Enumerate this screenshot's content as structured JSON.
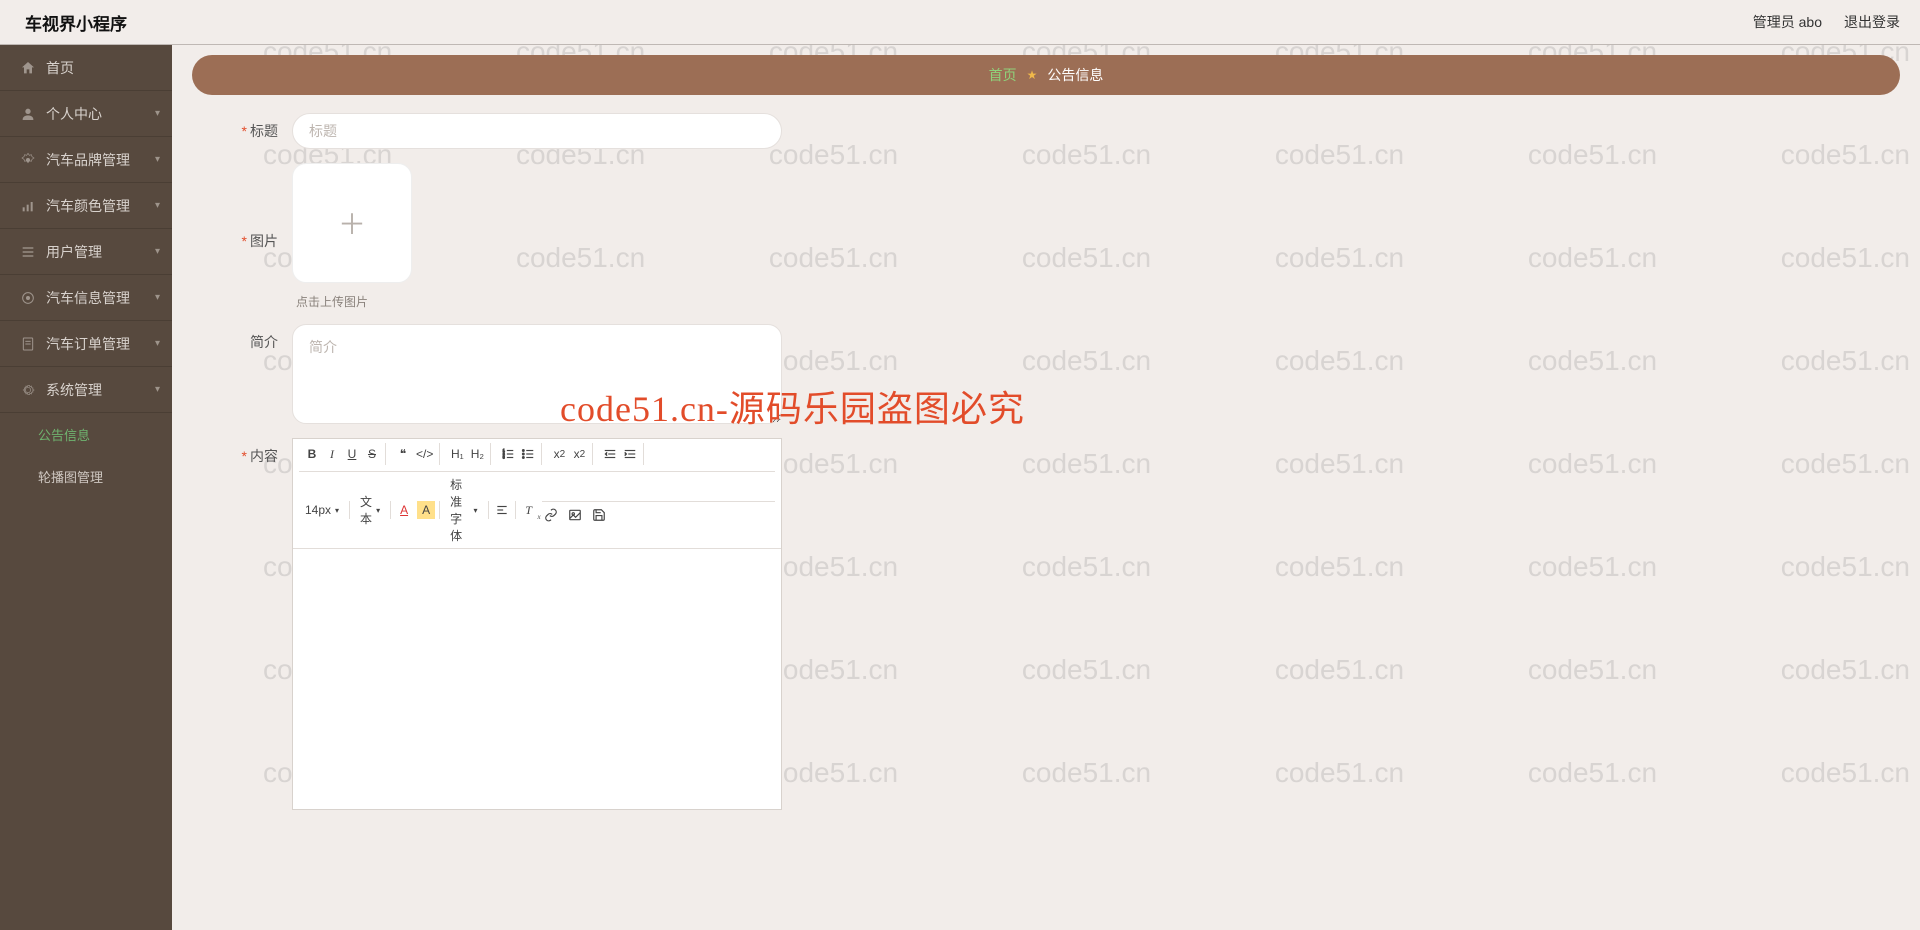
{
  "header": {
    "title": "车视界小程序",
    "adminLabel": "管理员 abo",
    "logoutLabel": "退出登录"
  },
  "sidebar": {
    "items": [
      {
        "id": "home",
        "label": "首页",
        "icon": "home-icon",
        "hasChevron": false
      },
      {
        "id": "profile",
        "label": "个人中心",
        "icon": "user-icon",
        "hasChevron": true
      },
      {
        "id": "brand",
        "label": "汽车品牌管理",
        "icon": "gear-icon",
        "hasChevron": true
      },
      {
        "id": "color",
        "label": "汽车颜色管理",
        "icon": "bars-icon",
        "hasChevron": true
      },
      {
        "id": "users",
        "label": "用户管理",
        "icon": "list-icon",
        "hasChevron": true
      },
      {
        "id": "info",
        "label": "汽车信息管理",
        "icon": "gear-icon",
        "hasChevron": true
      },
      {
        "id": "orders",
        "label": "汽车订单管理",
        "icon": "doc-icon",
        "hasChevron": true
      },
      {
        "id": "system",
        "label": "系统管理",
        "icon": "cog-icon",
        "hasChevron": true
      }
    ],
    "subItems": [
      {
        "id": "notice",
        "label": "公告信息",
        "active": true
      },
      {
        "id": "carousel",
        "label": "轮播图管理",
        "active": false
      }
    ]
  },
  "breadcrumb": {
    "home": "首页",
    "current": "公告信息"
  },
  "form": {
    "titleLabel": "标题",
    "titlePlaceholder": "标题",
    "imageLabel": "图片",
    "uploadHint": "点击上传图片",
    "introLabel": "简介",
    "introPlaceholder": "简介",
    "contentLabel": "内容"
  },
  "editor": {
    "fontSizeLabel": "14px",
    "textTypeLabel": "文本",
    "fontFamilyLabel": "标准字体",
    "h1": "H₁",
    "h2": "H₂"
  },
  "watermark": {
    "text": "code51.cn",
    "bigText": "code51.cn-源码乐园盗图必究"
  }
}
